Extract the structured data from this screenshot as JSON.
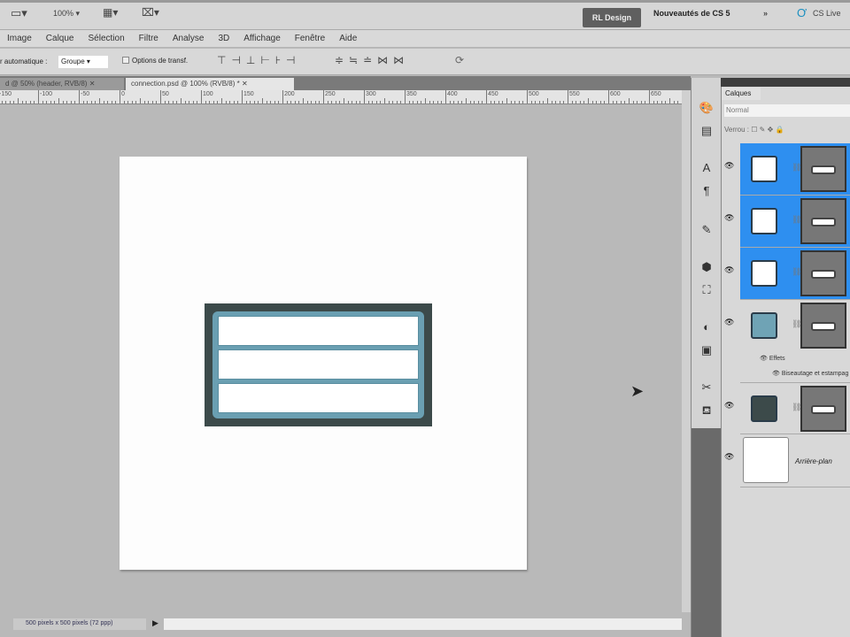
{
  "appbar": {
    "zoom": "100%",
    "workspace": "RL Design",
    "whats_new": "Nouveautés de CS 5",
    "more": "»",
    "cs_live": "CS Live"
  },
  "menu": [
    "Image",
    "Calque",
    "Sélection",
    "Filtre",
    "Analyse",
    "3D",
    "Affichage",
    "Fenêtre",
    "Aide"
  ],
  "options": {
    "auto_select_label": "r automatique :",
    "auto_select_value": "Groupe",
    "transform_option": "Options de transf."
  },
  "tabs": [
    {
      "label": "d @ 50% (header, RVB/8)",
      "active": false
    },
    {
      "label": "connection.psd @ 100% (RVB/8) *",
      "active": true
    }
  ],
  "ruler": {
    "labels": [
      "-150",
      "-100",
      "-50",
      "0",
      "50",
      "100",
      "150",
      "200",
      "250",
      "300",
      "350",
      "400",
      "450",
      "500",
      "550",
      "600",
      "650"
    ]
  },
  "document": {
    "fields": 3
  },
  "status": {
    "doc_info": "500 pixels x 500 pixels (72 ppp)"
  },
  "layers_panel": {
    "tab": "Calques",
    "blend_mode": "Normal",
    "lock_label": "Verrou :",
    "layers": [
      {
        "selected": true,
        "thumb_color": "#ffffff"
      },
      {
        "selected": true,
        "thumb_color": "#ffffff"
      },
      {
        "selected": true,
        "thumb_color": "#ffffff"
      },
      {
        "selected": false,
        "thumb_color": "#6fa3b5",
        "effects_label": "Effets",
        "effect": "Biseautage et estampage"
      },
      {
        "selected": false,
        "thumb_color": "#3c4a4a"
      },
      {
        "selected": false,
        "name": "Arrière-plan"
      }
    ]
  }
}
